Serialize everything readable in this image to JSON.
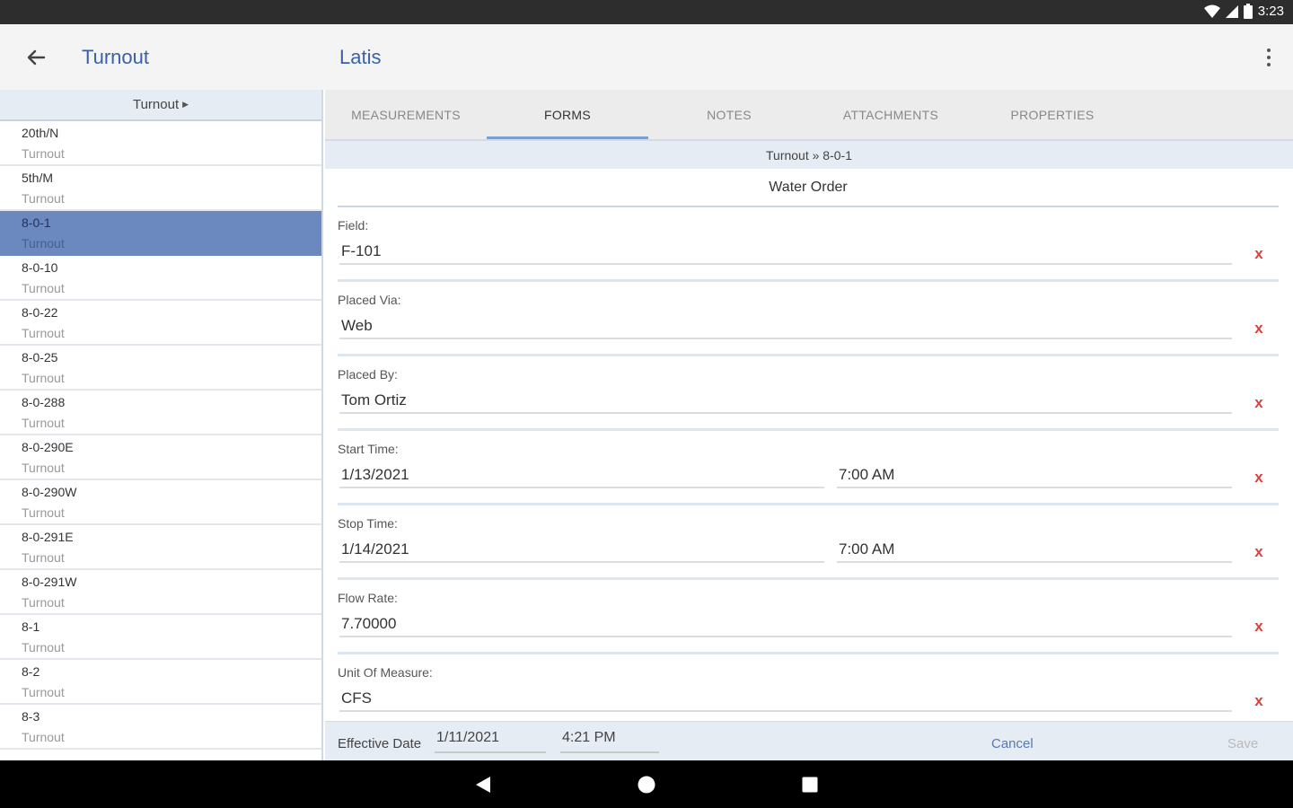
{
  "status_bar": {
    "time": "3:23"
  },
  "app_bar": {
    "left_title": "Turnout",
    "main_title": "Latis"
  },
  "sidebar": {
    "header": "Turnout",
    "items": [
      {
        "name": "20th/N",
        "type": "Turnout"
      },
      {
        "name": "5th/M",
        "type": "Turnout"
      },
      {
        "name": "8-0-1",
        "type": "Turnout"
      },
      {
        "name": "8-0-10",
        "type": "Turnout"
      },
      {
        "name": "8-0-22",
        "type": "Turnout"
      },
      {
        "name": "8-0-25",
        "type": "Turnout"
      },
      {
        "name": "8-0-288",
        "type": "Turnout"
      },
      {
        "name": "8-0-290E",
        "type": "Turnout"
      },
      {
        "name": "8-0-290W",
        "type": "Turnout"
      },
      {
        "name": "8-0-291E",
        "type": "Turnout"
      },
      {
        "name": "8-0-291W",
        "type": "Turnout"
      },
      {
        "name": "8-1",
        "type": "Turnout"
      },
      {
        "name": "8-2",
        "type": "Turnout"
      },
      {
        "name": "8-3",
        "type": "Turnout"
      }
    ],
    "selected_index": 2
  },
  "tabs": [
    {
      "label": "MEASUREMENTS"
    },
    {
      "label": "FORMS"
    },
    {
      "label": "NOTES"
    },
    {
      "label": "ATTACHMENTS"
    },
    {
      "label": "PROPERTIES"
    }
  ],
  "active_tab": "FORMS",
  "breadcrumb": "Turnout » 8-0-1",
  "form": {
    "title": "Water Order",
    "field": {
      "label": "Field:",
      "value": "F-101"
    },
    "placed_via": {
      "label": "Placed Via:",
      "value": "Web"
    },
    "placed_by": {
      "label": "Placed By:",
      "value": "Tom Ortiz"
    },
    "start_time": {
      "label": "Start Time:",
      "date": "1/13/2021",
      "time": "7:00 AM"
    },
    "stop_time": {
      "label": "Stop Time:",
      "date": "1/14/2021",
      "time": "7:00 AM"
    },
    "flow_rate": {
      "label": "Flow Rate:",
      "value": "7.70000"
    },
    "unit_of_measure": {
      "label": "Unit Of Measure:",
      "value": "CFS"
    },
    "clear_glyph": "x"
  },
  "footer": {
    "effective_label": "Effective Date",
    "effective_date": "1/11/2021",
    "effective_time": "4:21 PM",
    "cancel_label": "Cancel",
    "save_label": "Save"
  },
  "colors": {
    "accent": "#3a61a6",
    "selected_row": "#6b88bf",
    "clear_red": "#d94040"
  }
}
